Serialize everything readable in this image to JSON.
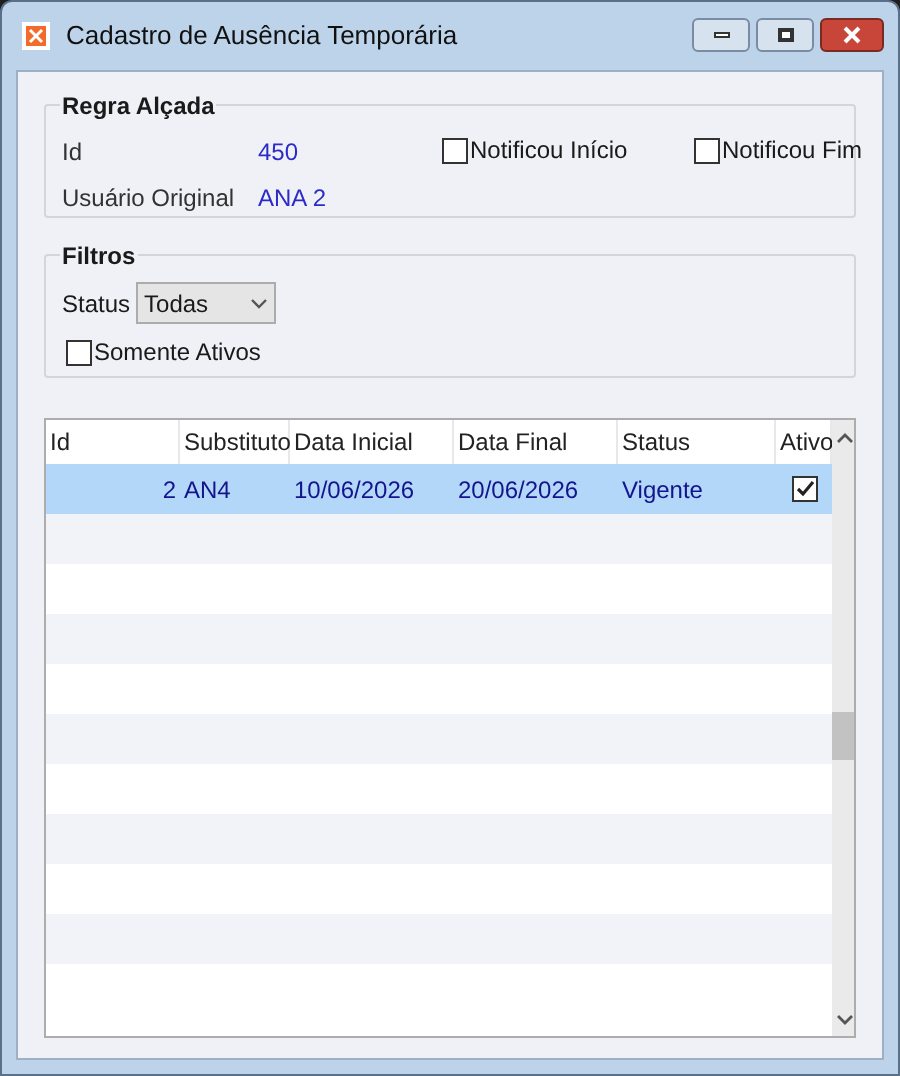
{
  "window": {
    "title": "Cadastro de Ausência Temporária"
  },
  "regra": {
    "title": "Regra Alçada",
    "fields": [
      {
        "label": "Id",
        "value": "450"
      },
      {
        "label": "Usuário Original",
        "value": "ANA 2"
      }
    ],
    "checkboxes": [
      {
        "label": "Notificou Início",
        "checked": false
      },
      {
        "label": "Notificou Fim",
        "checked": false
      }
    ]
  },
  "filtros": {
    "title": "Filtros",
    "status_label": "Status",
    "status_value": "Todas",
    "somente_ativos": {
      "label": "Somente Ativos",
      "checked": false
    }
  },
  "table": {
    "columns": [
      "Id",
      "Substituto",
      "Data Inicial",
      "Data Final",
      "Status",
      "Ativo"
    ],
    "rows": [
      {
        "cells": [
          "2",
          "AN4",
          "10/06/2026",
          "20/06/2026",
          "Vigente"
        ],
        "ativo": true,
        "selected": true
      }
    ]
  }
}
